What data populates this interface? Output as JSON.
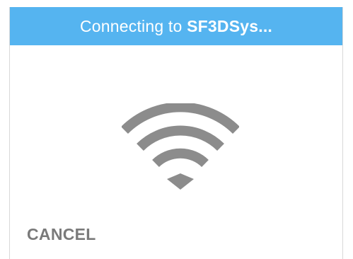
{
  "dialog": {
    "title_prefix": "Connecting to ",
    "network_name": "SF3DSys...",
    "status_icon": "wifi-icon",
    "cancel_label": "CANCEL"
  },
  "colors": {
    "header_bg": "#55b4f0",
    "header_text": "#ffffff",
    "icon": "#8c8c8c",
    "cancel_text": "#7a7a7a"
  }
}
